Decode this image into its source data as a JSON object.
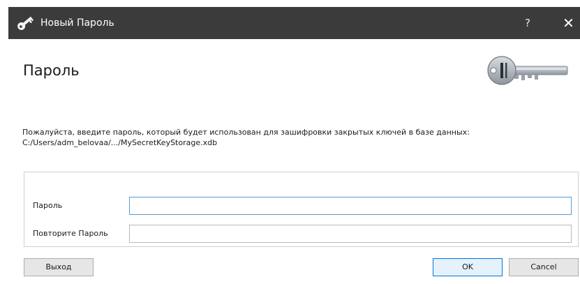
{
  "window": {
    "title": "Новый Пароль",
    "help_label": "?",
    "close_label": "✕"
  },
  "header": {
    "title": "Пароль"
  },
  "description": {
    "line1": "Пожалуйста, введите пароль, который будет использован для зашифровки закрытых ключей в базе данных:",
    "line2": "C:/Users/adm_belovaa/.../MySecretKeyStorage.xdb"
  },
  "form": {
    "password_label": "Пароль",
    "password_value": "",
    "repeat_label": "Повторите Пароль",
    "repeat_value": ""
  },
  "buttons": {
    "exit_label": "Выход",
    "ok_label": "OK",
    "cancel_label": "Cancel"
  },
  "icons": {
    "title_icon": "key-icon",
    "header_icon": "key-icon"
  },
  "colors": {
    "titlebar": "#3b3b3b",
    "focus_border": "#5b9bd5",
    "default_button_border": "#0078d7"
  }
}
